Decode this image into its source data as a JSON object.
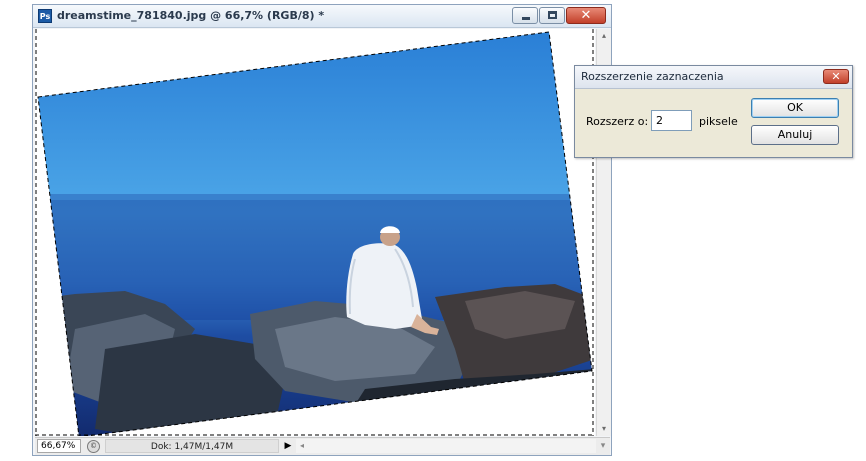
{
  "window": {
    "app_icon_text": "Ps",
    "title": "dreamstime_781840.jpg @ 66,7% (RGB/8) *",
    "minimize_glyph": "",
    "restore_glyph": "",
    "close_glyph": "✕"
  },
  "image": {
    "description_icon": "photo-man-on-rocks",
    "colors": {
      "sky_top": "#1e6fc8",
      "sky_bottom": "#3b8fda",
      "sea": "#1d4a9e",
      "rocks": "#2b3340"
    }
  },
  "statusbar": {
    "zoom": "66,67%",
    "doc_info": "Dok: 1,47M/1,47M",
    "arrow": "▶",
    "scroll_left": "◂",
    "grip": "▾"
  },
  "scrollbar": {
    "up": "▴",
    "down": "▾"
  },
  "dialog": {
    "title": "Rozszerzenie zaznaczenia",
    "close_glyph": "✕",
    "label": "Rozszerz o:",
    "value": "2",
    "unit": "piksele",
    "ok_label": "OK",
    "cancel_label": "Anuluj"
  }
}
